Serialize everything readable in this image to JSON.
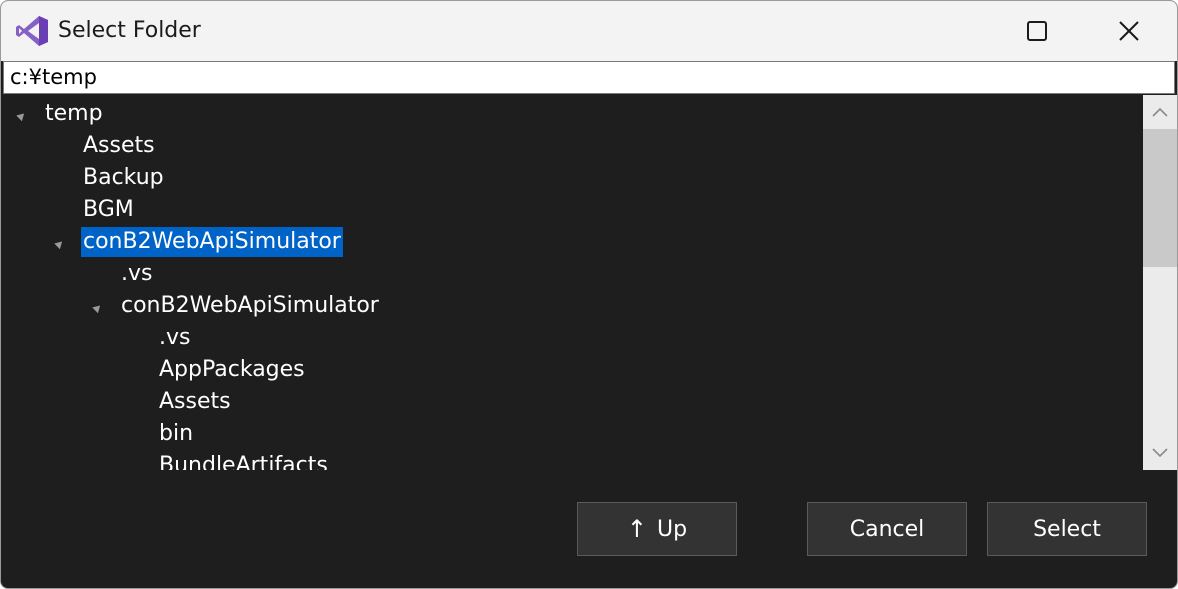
{
  "window": {
    "title": "Select Folder",
    "app_icon": "visual-studio-icon"
  },
  "caption_buttons": {
    "minimize": "minimize-icon",
    "maximize": "maximize-icon",
    "close": "close-icon"
  },
  "path": {
    "value": "c:¥temp"
  },
  "tree": {
    "nodes": [
      {
        "label": "temp",
        "level": 0,
        "expanded": true,
        "selected": false
      },
      {
        "label": "Assets",
        "level": 1,
        "expanded": false,
        "selected": false
      },
      {
        "label": "Backup",
        "level": 1,
        "expanded": false,
        "selected": false
      },
      {
        "label": "BGM",
        "level": 1,
        "expanded": false,
        "selected": false
      },
      {
        "label": "conB2WebApiSimulator",
        "level": 1,
        "expanded": true,
        "selected": true
      },
      {
        "label": ".vs",
        "level": 2,
        "expanded": false,
        "selected": false
      },
      {
        "label": "conB2WebApiSimulator",
        "level": 2,
        "expanded": true,
        "selected": false
      },
      {
        "label": ".vs",
        "level": 3,
        "expanded": false,
        "selected": false
      },
      {
        "label": "AppPackages",
        "level": 3,
        "expanded": false,
        "selected": false
      },
      {
        "label": "Assets",
        "level": 3,
        "expanded": false,
        "selected": false
      },
      {
        "label": "bin",
        "level": 3,
        "expanded": false,
        "selected": false
      },
      {
        "label": "BundleArtifacts",
        "level": 3,
        "expanded": false,
        "selected": false
      }
    ]
  },
  "buttons": {
    "up": "Up",
    "up_arrow": "↑",
    "cancel": "Cancel",
    "select": "Select"
  },
  "colors": {
    "selection": "#0063c7",
    "tree_background": "#1e1e1e",
    "button_background": "#333333"
  }
}
